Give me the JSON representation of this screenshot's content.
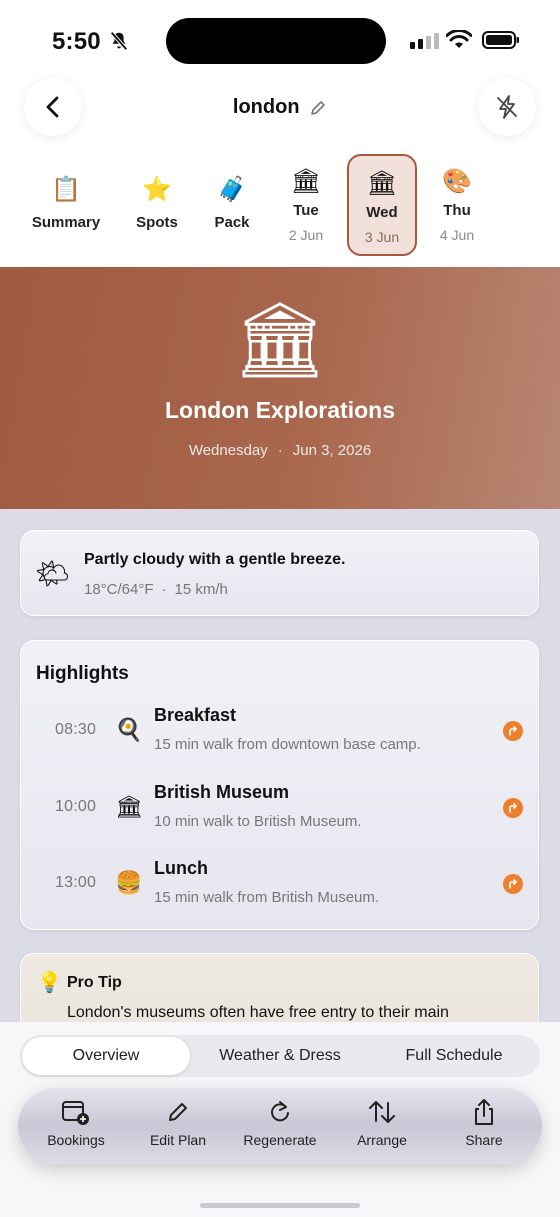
{
  "status_bar": {
    "time": "5:50"
  },
  "nav": {
    "title": "london"
  },
  "tabs": [
    {
      "emoji": "📋",
      "label": "Summary",
      "sub": ""
    },
    {
      "emoji": "⭐",
      "label": "Spots",
      "sub": ""
    },
    {
      "emoji": "🧳",
      "label": "Pack",
      "sub": ""
    },
    {
      "emoji": "🏛",
      "label": "Tue",
      "sub": "2 Jun"
    },
    {
      "emoji": "🏛",
      "label": "Wed",
      "sub": "3 Jun"
    },
    {
      "emoji": "🎨",
      "label": "Thu",
      "sub": "4 Jun"
    }
  ],
  "hero": {
    "emoji": "🏛",
    "title": "London Explorations",
    "weekday": "Wednesday",
    "separator": "·",
    "date": "Jun 3, 2026"
  },
  "weather": {
    "emoji": "🌤",
    "summary": "Partly cloudy with a gentle breeze.",
    "temp": "18°C/64°F",
    "separator": "·",
    "wind": "15 km/h"
  },
  "highlights": {
    "title": "Highlights",
    "items": [
      {
        "time": "08:30",
        "emoji": "🍳",
        "title": "Breakfast",
        "sub": "15 min walk from downtown base camp."
      },
      {
        "time": "10:00",
        "emoji": "🏛",
        "title": "British Museum",
        "sub": "10 min walk to British Museum."
      },
      {
        "time": "13:00",
        "emoji": "🍔",
        "title": "Lunch",
        "sub": "15 min walk from British Museum."
      }
    ]
  },
  "tip": {
    "emoji": "💡",
    "title": "Pro Tip",
    "body": "London's museums often have free entry to their main"
  },
  "segments": [
    "Overview",
    "Weather & Dress",
    "Full Schedule"
  ],
  "toolbar": [
    {
      "icon": "calendar-add-icon",
      "label": "Bookings"
    },
    {
      "icon": "pencil-icon",
      "label": "Edit Plan"
    },
    {
      "icon": "refresh-icon",
      "label": "Regenerate"
    },
    {
      "icon": "arrange-icon",
      "label": "Arrange"
    },
    {
      "icon": "share-icon",
      "label": "Share"
    }
  ],
  "colors": {
    "accent": "#a55a3e",
    "hero": "#a9674d",
    "orange": "#ee7f2d"
  }
}
